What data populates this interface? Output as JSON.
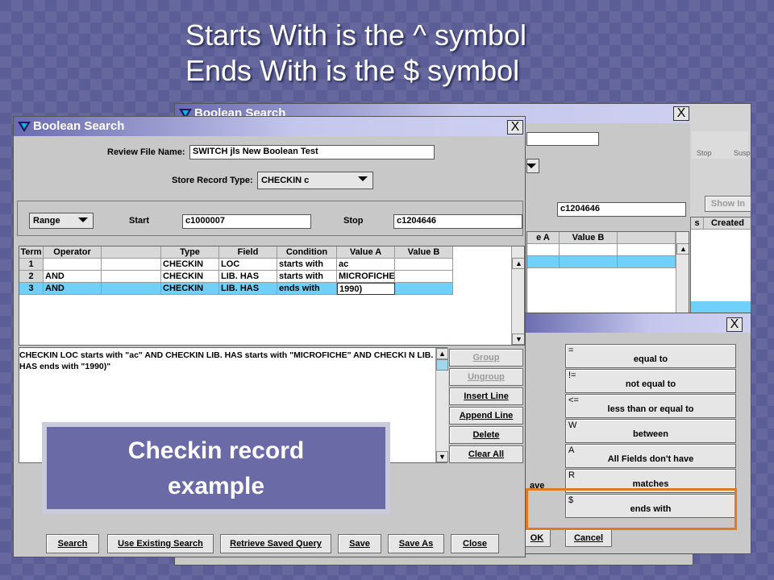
{
  "slide": {
    "title_line1": "Starts With is the ^ symbol",
    "title_line2": "Ends With is the $ symbol"
  },
  "back_window": {
    "title": "Boolean Search",
    "close": "X",
    "toolbar": [
      "Stop",
      "Susp"
    ],
    "stop_value": "c1204646",
    "show_button": "Show In",
    "right_headers": [
      "s",
      "Created"
    ],
    "grid_headers": [
      "e A",
      "Value B"
    ]
  },
  "main_window": {
    "title": "Boolean Search",
    "close": "X",
    "review_label": "Review File Name:",
    "review_value": "SWITCH jls New Boolean Test",
    "store_label": "Store Record Type:",
    "store_value": "CHECKIN c",
    "range_value": "Range",
    "start_label": "Start",
    "start_value": "c1000007",
    "stop_label": "Stop",
    "stop_value": "c1204646",
    "columns": [
      "Term",
      "Operator",
      "",
      "Type",
      "Field",
      "Condition",
      "Value A",
      "Value B"
    ],
    "rows": [
      {
        "term": "1",
        "operator": "",
        "type": "CHECKIN",
        "field": "LOC",
        "condition": "starts with",
        "value_a": "ac",
        "value_b": ""
      },
      {
        "term": "2",
        "operator": "AND",
        "type": "CHECKIN",
        "field": "LIB. HAS",
        "condition": "starts with",
        "value_a": "MICROFICHE",
        "value_b": ""
      },
      {
        "term": "3",
        "operator": "AND",
        "type": "CHECKIN",
        "field": "LIB. HAS",
        "condition": "ends with",
        "value_a": "1990)",
        "value_b": ""
      }
    ],
    "query_text": "CHECKIN  LOC  starts with  \"ac\"    AND CHECKIN  LIB. HAS  starts with  \"MICROFICHE\"    AND CHECKI N  LIB. HAS  ends with  \"1990)\"",
    "side_buttons": [
      "Group",
      "Ungroup",
      "Insert Line",
      "Append Line",
      "Delete",
      "Clear All"
    ],
    "bottom_buttons": [
      "Search",
      "Use Existing Search",
      "Retrieve Saved Query",
      "Save",
      "Save As",
      "Close"
    ]
  },
  "operator_dialog": {
    "close": "X",
    "operators": [
      {
        "symbol": "=",
        "label": "equal to"
      },
      {
        "symbol": "!=",
        "label": "not equal to"
      },
      {
        "symbol": "<=",
        "label": "less than or equal to"
      },
      {
        "symbol": "W",
        "label": "between"
      },
      {
        "symbol": "A",
        "label": "All Fields don't have"
      },
      {
        "symbol": "R",
        "label": "matches"
      },
      {
        "symbol": "$",
        "label": "ends with"
      }
    ],
    "partial_label": "ave",
    "ok": "OK",
    "cancel": "Cancel"
  },
  "callout": {
    "line1": "Checkin record",
    "line2": "example"
  },
  "colors": {
    "selection": "#70d0f8",
    "highlight_box": "#e07a20",
    "background": "#5a5d96"
  }
}
